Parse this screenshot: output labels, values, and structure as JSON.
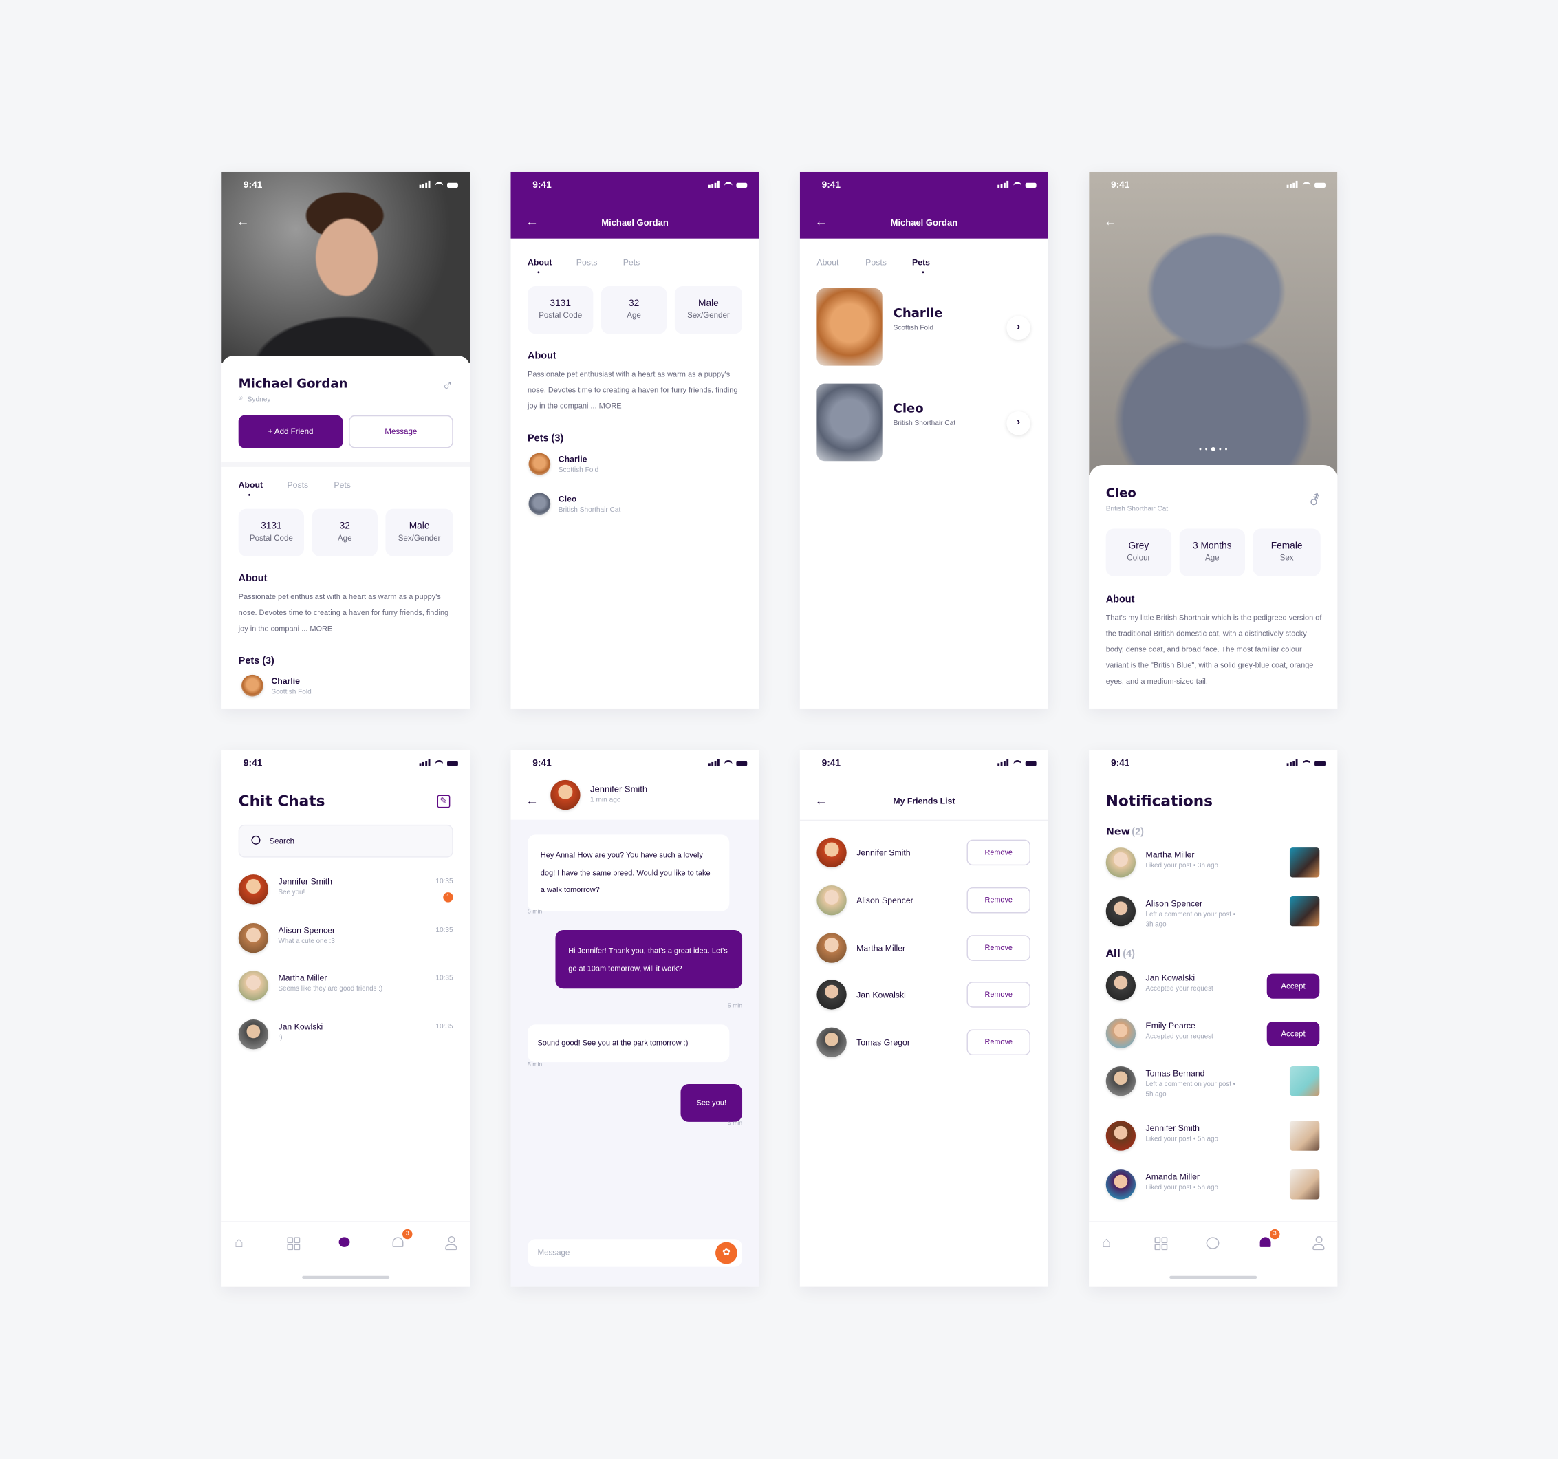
{
  "status_time": "9:41",
  "colors": {
    "primary": "#600b85",
    "accent": "#f26b2a",
    "text": "#1e0a3c",
    "muted": "#a3a8b8",
    "surface": "#f6f6fb",
    "background": "#f5f6f8"
  },
  "profile": {
    "name": "Michael Gordan",
    "location": "Sydney",
    "gender_icon": "male-icon",
    "add_friend": "+ Add Friend",
    "message": "Message",
    "tabs": [
      "About",
      "Posts",
      "Pets"
    ],
    "stats": [
      {
        "value": "3131",
        "label": "Postal Code"
      },
      {
        "value": "32",
        "label": "Age"
      },
      {
        "value": "Male",
        "label": "Sex/Gender"
      }
    ],
    "about_title": "About",
    "about_text": "Passionate pet enthusiast with a heart as warm as a puppy's nose. Devotes time to creating a haven for furry friends, finding joy in the compani ... MORE",
    "pets_title": "Pets (3)",
    "pets": [
      {
        "name": "Charlie",
        "breed": "Scottish Fold"
      },
      {
        "name": "Cleo",
        "breed": "British Shorthair Cat"
      }
    ]
  },
  "pet_detail": {
    "name": "Cleo",
    "breed": "British Shorthair Cat",
    "gender_icon": "gender-icon",
    "carousel": {
      "count": 5,
      "active": 3
    },
    "stats": [
      {
        "value": "Grey",
        "label": "Colour"
      },
      {
        "value": "3 Months",
        "label": "Age"
      },
      {
        "value": "Female",
        "label": "Sex"
      }
    ],
    "about_title": "About",
    "about_text": "That's my little British Shorthair which is the pedigreed version of the traditional British domestic cat, with a distinctively stocky body, dense coat, and broad face. The most familiar colour variant is the \"British Blue\", with a solid grey-blue coat, orange eyes, and a medium-sized tail."
  },
  "chats": {
    "title": "Chit Chats",
    "search_placeholder": "Search",
    "items": [
      {
        "name": "Jennifer Smith",
        "preview": "See you!",
        "time": "10:35",
        "unread": "1"
      },
      {
        "name": "Alison Spencer",
        "preview": "What a cute one :3",
        "time": "10:35"
      },
      {
        "name": "Martha Miller",
        "preview": "Seems like they are good friends :)",
        "time": "10:35"
      },
      {
        "name": "Jan Kowlski",
        "preview": ":)",
        "time": "10:35"
      }
    ],
    "nav_badge": "3"
  },
  "conversation": {
    "contact": "Jennifer Smith",
    "last_seen": "1 min ago",
    "messages": [
      {
        "from": "them",
        "text": "Hey Anna! How are you? You have such a lovely dog! I have the same breed. Would you like to take a walk tomorrow?",
        "time": "5 min"
      },
      {
        "from": "me",
        "text": "Hi Jennifer! Thank you, that's a great idea. Let's go at 10am tomorrow, will it work?",
        "time": "5 min"
      },
      {
        "from": "them",
        "text": "Sound good! See you at the park tomorrow :)",
        "time": "5 min"
      },
      {
        "from": "me",
        "text": "See you!",
        "time": "5 min"
      }
    ],
    "input_placeholder": "Message"
  },
  "friends": {
    "title": "My Friends List",
    "remove_label": "Remove",
    "items": [
      "Jennifer Smith",
      "Alison Spencer",
      "Martha Miller",
      "Jan Kowalski",
      "Tomas Gregor"
    ]
  },
  "notifications": {
    "title": "Notifications",
    "new_label": "New",
    "new_count": "(2)",
    "all_label": "All",
    "all_count": "(4)",
    "accept_label": "Accept",
    "new_items": [
      {
        "name": "Martha Miller",
        "text": "Liked your post • 3h ago"
      },
      {
        "name": "Alison Spencer",
        "text": "Left a comment on your post •",
        "text2": "3h ago"
      }
    ],
    "all_items": [
      {
        "name": "Jan Kowalski",
        "text": "Accepted your request",
        "action": "accept"
      },
      {
        "name": "Emily Pearce",
        "text": "Accepted your request",
        "action": "accept"
      },
      {
        "name": "Tomas Bernand",
        "text": "Left a comment on your post •",
        "text2": "5h ago"
      },
      {
        "name": "Jennifer Smith",
        "text": "Liked your post • 5h ago"
      },
      {
        "name": "Amanda Miller",
        "text": "Liked your post • 5h ago"
      }
    ],
    "nav_badge": "3"
  }
}
